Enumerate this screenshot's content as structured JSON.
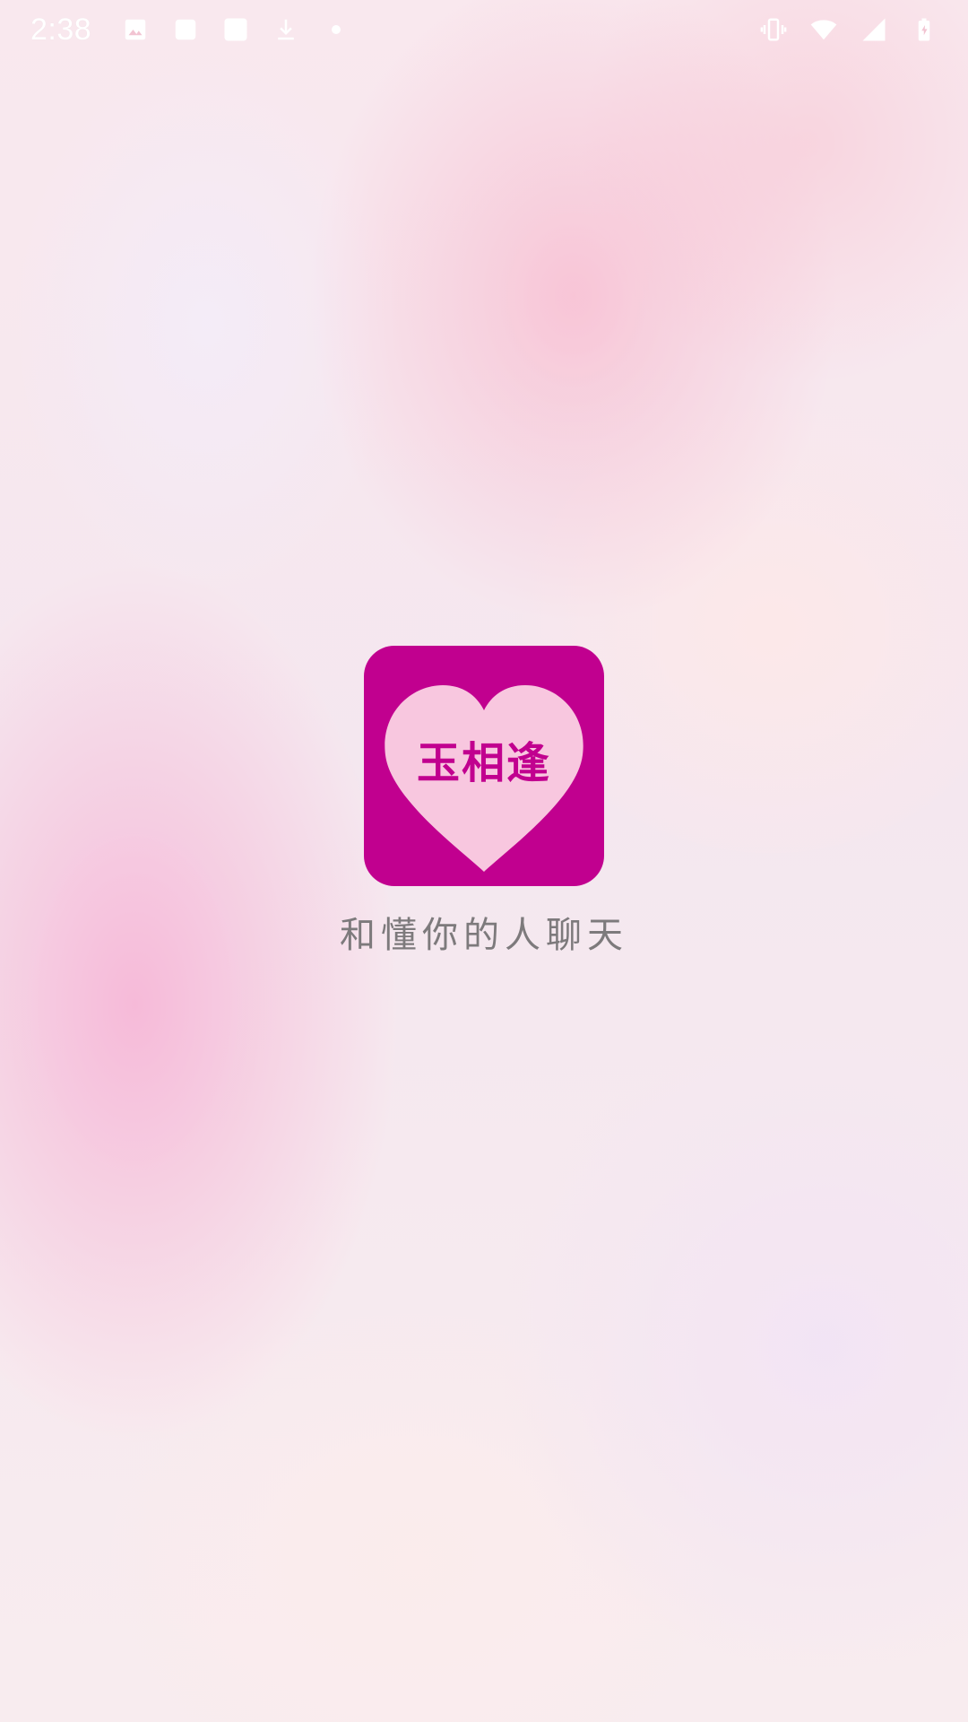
{
  "status_bar": {
    "time": "2:38",
    "left_icons": [
      "image-icon",
      "square-icon",
      "square-icon",
      "download-icon",
      "dot-icon"
    ],
    "right_icons": [
      "vibrate-icon",
      "wifi-icon",
      "signal-icon",
      "battery-icon"
    ]
  },
  "splash": {
    "logo_text": "玉相逢",
    "tagline": "和懂你的人聊天"
  },
  "colors": {
    "brand": "#c1008f",
    "heart": "#f8c7df",
    "tagline": "#7d7a7c"
  }
}
